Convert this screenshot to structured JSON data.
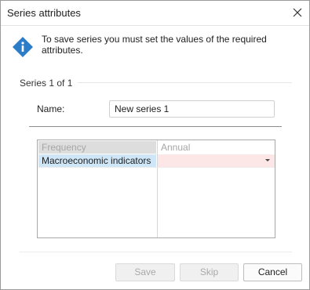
{
  "dialog": {
    "title": "Series attributes",
    "info_message": "To save series you must set the values of the required attributes."
  },
  "section": {
    "title": "Series 1 of 1"
  },
  "form": {
    "name_label": "Name:",
    "name_value": "New series 1"
  },
  "attributes_grid": {
    "rows": [
      {
        "attribute": "Frequency",
        "value": "Annual"
      },
      {
        "attribute": "Macroeconomic indicators",
        "value": ""
      }
    ]
  },
  "buttons": {
    "save": "Save",
    "skip": "Skip",
    "cancel": "Cancel"
  },
  "icons": {
    "info": "info-icon",
    "close": "close-icon",
    "dropdown": "chevron-down-icon"
  },
  "colors": {
    "info_icon": "#2b7dc7",
    "required_cell": "#fde6e6",
    "selected_cell": "#cfe6f7"
  }
}
